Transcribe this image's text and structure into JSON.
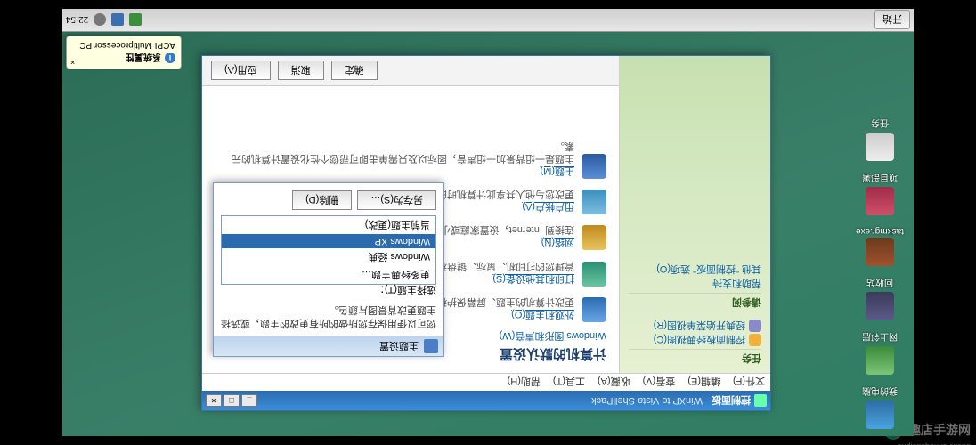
{
  "watermark": {
    "site_cn": "趣店手游网",
    "site_url": "oudianshouyouwang"
  },
  "taskbar": {
    "start": "开始",
    "clock": "22:54"
  },
  "balloon": {
    "title": "系统属性",
    "msg": "ACPI Multiprocessor PC",
    "close": "×"
  },
  "desktop_icons": [
    {
      "label": "我的电脑"
    },
    {
      "label": "网上邻居"
    },
    {
      "label": "回收站"
    },
    {
      "label": "taskmgr.exe"
    },
    {
      "label": "项目部署"
    },
    {
      "label": "任务"
    }
  ],
  "window": {
    "title": "控制面板",
    "title_suffix": "WinXP to Vista ShellPack",
    "ctrl_min": "_",
    "ctrl_max": "□",
    "ctrl_close": "×",
    "menu": [
      "文件(F)",
      "编辑(E)",
      "查看(V)",
      "收藏(A)",
      "工具(T)",
      "帮助(H)"
    ],
    "sidebar": {
      "sec1_title": "任务",
      "sec1_links": [
        "控制面板经典视图(C)",
        "经典开始菜单视图(R)"
      ],
      "sec2_title": "请参阅",
      "sec2_links": [
        "帮助和支持",
        "其他 \"控制面板\" 选项(O)"
      ]
    },
    "content": {
      "heading": "计算机的默认设置",
      "sub": "Windows 图形和声音(W)",
      "items": [
        {
          "title": "外观和主题(O)",
          "desc": "更改计算机的主题、屏幕保护程序或自定义并保存您自己的方案和样式。"
        },
        {
          "title": "打印和其他设备(S)",
          "desc": "管理您的打印机、鼠标、键盘和其他设备连接和配置。更新设备驱动程序。"
        },
        {
          "title": "网络(N)",
          "desc": "连接到 Internet，设置家庭或小型办公室网络，或配置网络设置。"
        },
        {
          "title": "用户帐户(A)",
          "desc": "更改您与他人共享此计算机时的用户帐户设置和密码。"
        },
        {
          "title": "主题(M)",
          "desc": "主题是一组背景加一组声音，图标以及只需单击即可帮您个性化设置计算机的元素。"
        }
      ]
    },
    "buttons": {
      "ok": "确定",
      "cancel": "取消",
      "apply": "应用(A)"
    }
  },
  "popup": {
    "head": "主题设置",
    "text": "您可以使用保存您所做的所有更改的主题，或选择主题更改背景图片颜色。",
    "selected": "选择主题(T)：",
    "options": [
      "更多经典主题…",
      "Windows 经典",
      "Windows XP",
      "当前主题(更改)"
    ],
    "selected_index": 2,
    "btn_save": "另存为(S)…",
    "btn_del": "删除(D)"
  }
}
